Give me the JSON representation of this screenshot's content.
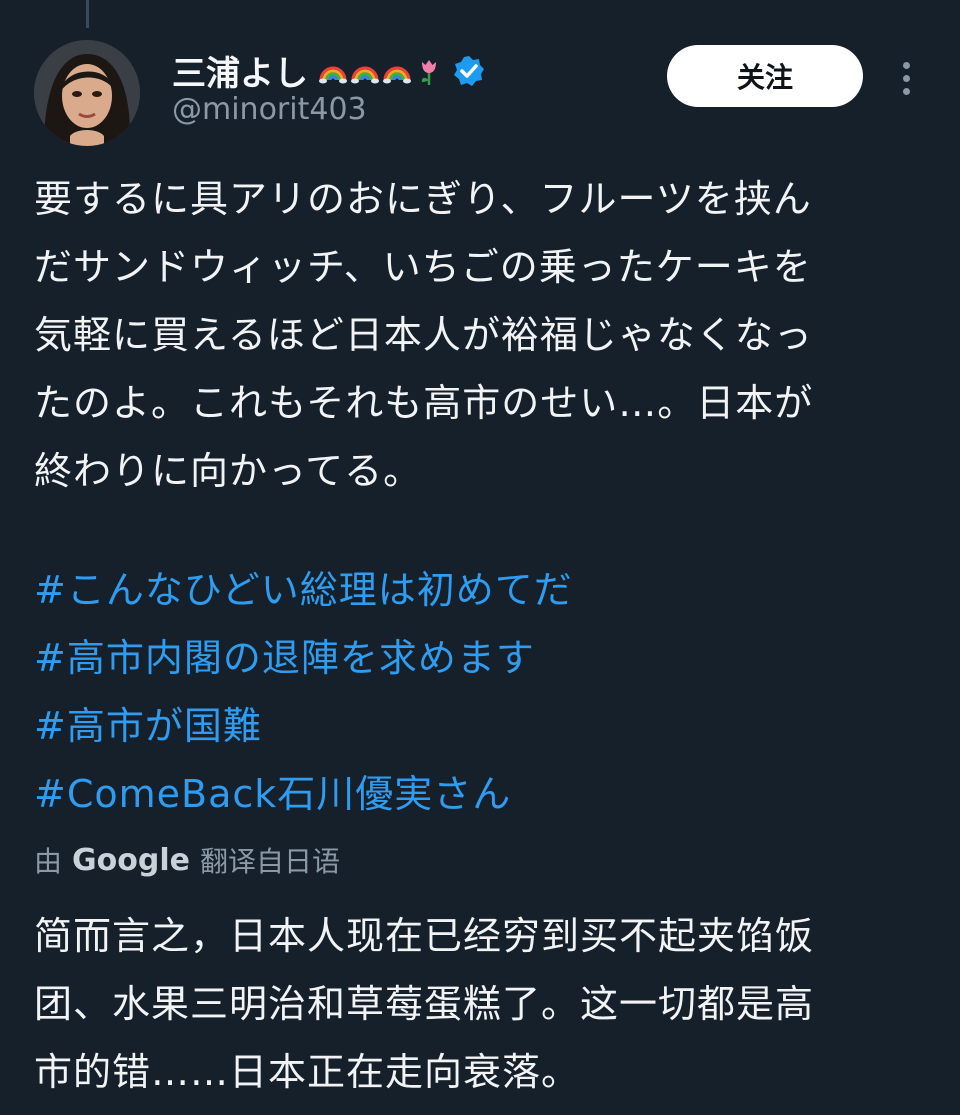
{
  "user": {
    "display_name": "三浦よし",
    "handle": "@minorit403",
    "emoji_icons": [
      "rainbow-icon",
      "rainbow-icon",
      "rainbow-icon",
      "tulip-icon"
    ],
    "verified_icon": "verified-badge-icon"
  },
  "actions": {
    "follow_label": "关注",
    "more_icon": "more-vertical-icon"
  },
  "post": {
    "lines": [
      "要するに具アリのおにぎり、フルーツを挟ん",
      "だサンドウィッチ、いちごの乗ったケーキを",
      "気軽に買えるほど日本人が裕福じゃなくなっ",
      "たのよ。これもそれも高市のせい…。日本が",
      "終わりに向かってる。"
    ],
    "hashtags": [
      "#こんなひどい総理は初めてだ",
      "#高市内閣の退陣を求めます",
      "#高市が国難",
      "#ComeBack石川優実さん"
    ]
  },
  "translation": {
    "by_label": "由",
    "provider": "Google",
    "source_label": "翻译自日语",
    "lines": [
      "简而言之，日本人现在已经穷到买不起夹馅饭",
      "团、水果三明治和草莓蛋糕了。这一切都是高",
      "市的错……日本正在走向衰落。"
    ]
  },
  "colors": {
    "background": "#15202b",
    "hashtag": "#2f9cf0",
    "secondary_text": "#8b98a5",
    "verified": "#1d9bf0"
  }
}
